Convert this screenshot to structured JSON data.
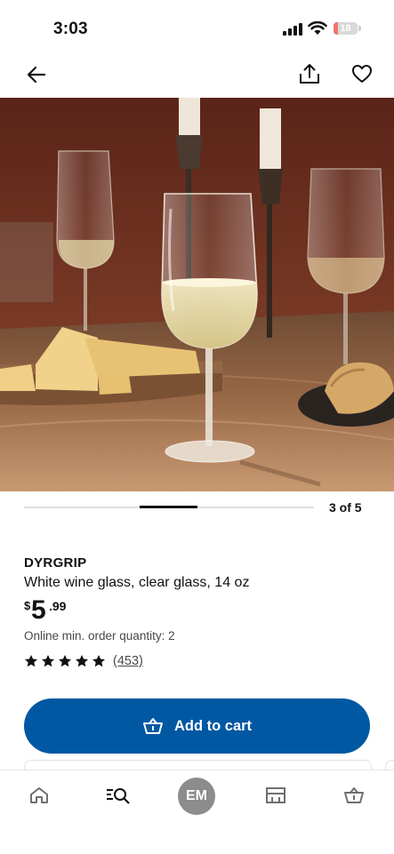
{
  "status_bar": {
    "time": "3:03",
    "battery_level": "18",
    "battery_fraction": 0.18,
    "battery_color": "#f07470"
  },
  "top_nav": {
    "icons": [
      "back-arrow-icon",
      "share-icon",
      "heart-icon"
    ]
  },
  "gallery": {
    "position": "3 of 5",
    "current": 3,
    "total": 5
  },
  "product": {
    "name": "DYRGRIP",
    "description": "White wine glass, clear glass, 14 oz",
    "price_currency": "$",
    "price_integer": "5",
    "price_decimal": ".99",
    "min_order": "Online min. order quantity: 2",
    "rating_stars": 5,
    "rating_count": "(453)"
  },
  "actions": {
    "add_to_cart": "Add to cart",
    "accent_color": "#0058a3"
  },
  "bottom_nav": {
    "items": [
      "home-icon",
      "search-icon",
      "profile",
      "store-icon",
      "cart-icon"
    ],
    "profile_initials": "EM"
  }
}
